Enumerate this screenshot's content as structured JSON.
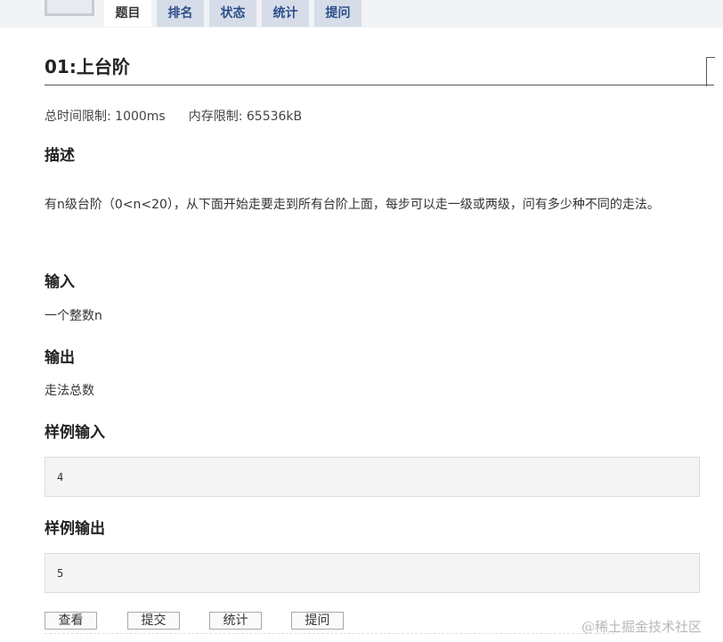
{
  "tabs": [
    {
      "label": "题目"
    },
    {
      "label": "排名"
    },
    {
      "label": "状态"
    },
    {
      "label": "统计"
    },
    {
      "label": "提问"
    }
  ],
  "problem": {
    "title": "01:上台阶",
    "time_limit": "总时间限制: 1000ms",
    "memory_limit": "内存限制: 65536kB",
    "description_heading": "描述",
    "description": "有n级台阶（0<n<20），从下面开始走要走到所有台阶上面，每步可以走一级或两级，问有多少种不同的走法。",
    "input_heading": "输入",
    "input": "一个整数n",
    "output_heading": "输出",
    "output": "走法总数",
    "sample_input_heading": "样例输入",
    "sample_input": "4",
    "sample_output_heading": "样例输出",
    "sample_output": "5"
  },
  "actions": {
    "view": "查看",
    "submit": "提交",
    "stats": "统计",
    "ask": "提问"
  },
  "watermark": "@稀土掘金技术社区"
}
